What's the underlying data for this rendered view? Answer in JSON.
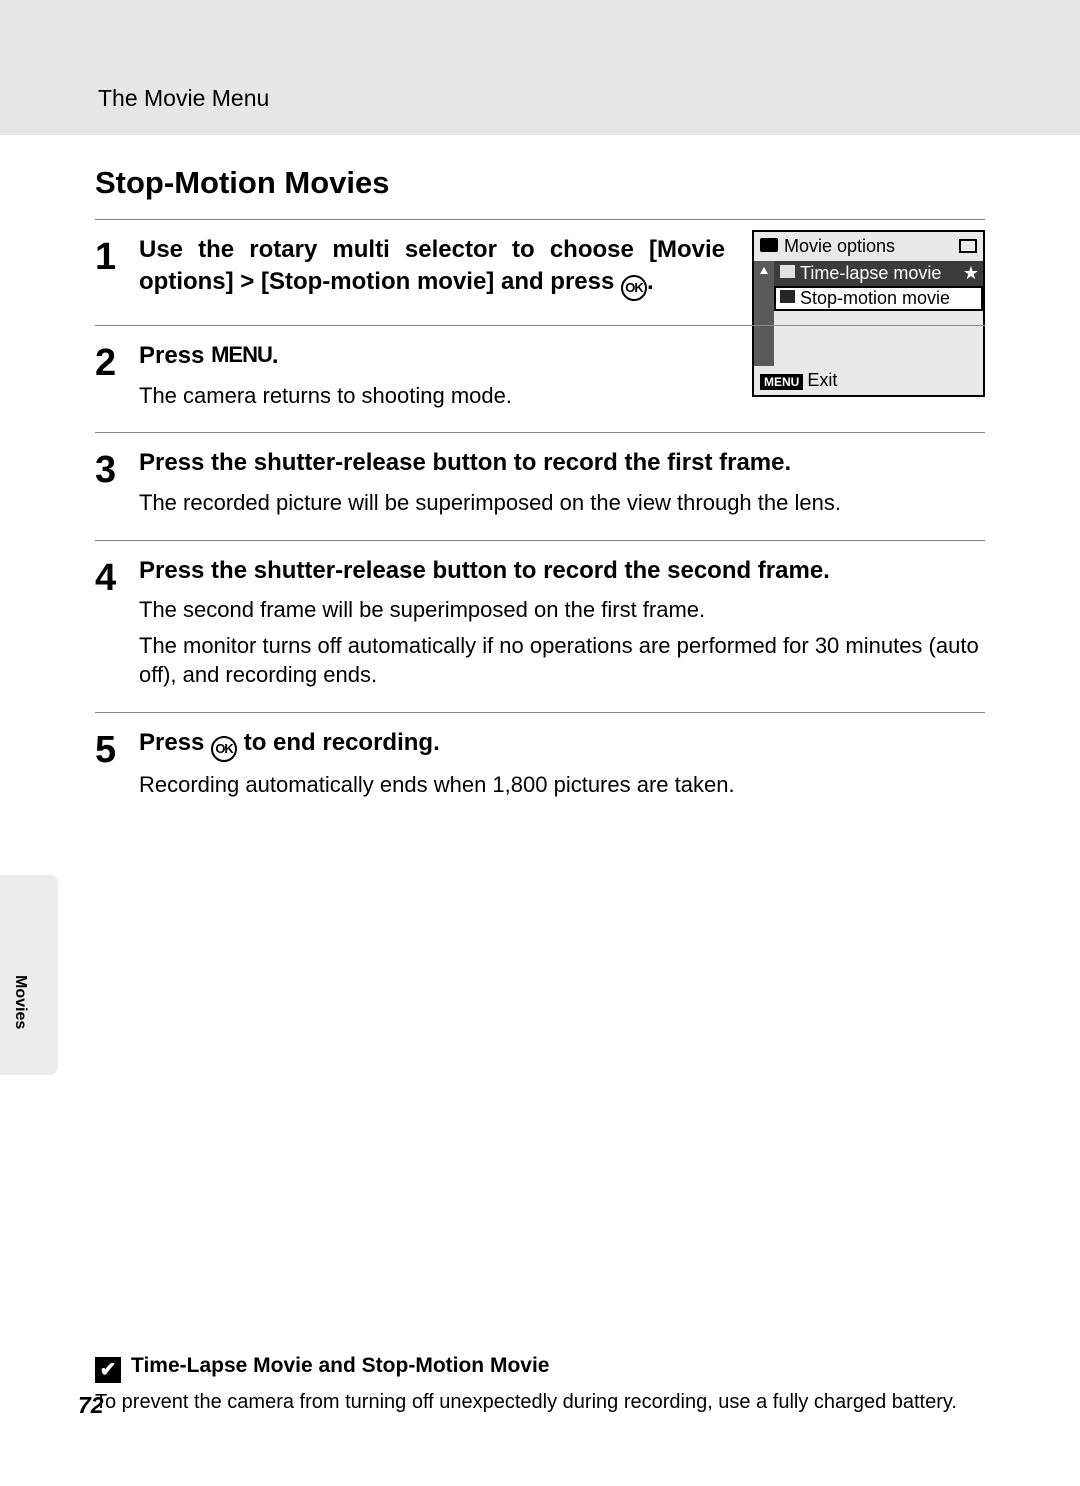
{
  "header": "The Movie Menu",
  "title": "Stop-Motion Movies",
  "ok_glyph": "OK",
  "menu_glyph": "MENU",
  "steps": [
    {
      "num": "1",
      "head_parts": [
        "Use the rotary multi selector to choose [Movie options] > [Stop-motion movie] and press ",
        "."
      ],
      "descs": []
    },
    {
      "num": "2",
      "head_parts": [
        "Press ",
        "."
      ],
      "descs": [
        "The camera returns to shooting mode."
      ]
    },
    {
      "num": "3",
      "head_plain": "Press the shutter-release button to record the first frame.",
      "descs": [
        "The recorded picture will be superimposed on the view through the lens."
      ]
    },
    {
      "num": "4",
      "head_plain": "Press the shutter-release button to record the second frame.",
      "descs": [
        "The second frame will be superimposed on the first frame.",
        "The monitor turns off automatically if no operations are performed for 30 minutes (auto off), and recording ends."
      ]
    },
    {
      "num": "5",
      "head_parts": [
        "Press ",
        " to end recording."
      ],
      "descs": [
        "Recording automatically ends when 1,800 pictures are taken."
      ]
    }
  ],
  "lcd": {
    "title": "Movie options",
    "rows": [
      {
        "label": "Time-lapse movie",
        "star": "★",
        "selected": true
      },
      {
        "label": "Stop-motion movie",
        "boxed": true
      }
    ],
    "foot_menu": "MENU",
    "foot_label": "Exit"
  },
  "side_tab": "Movies",
  "note": {
    "title": "Time-Lapse Movie and Stop-Motion Movie",
    "body": "To prevent the camera from turning off unexpectedly during recording, use a fully charged battery."
  },
  "page_number": "72"
}
